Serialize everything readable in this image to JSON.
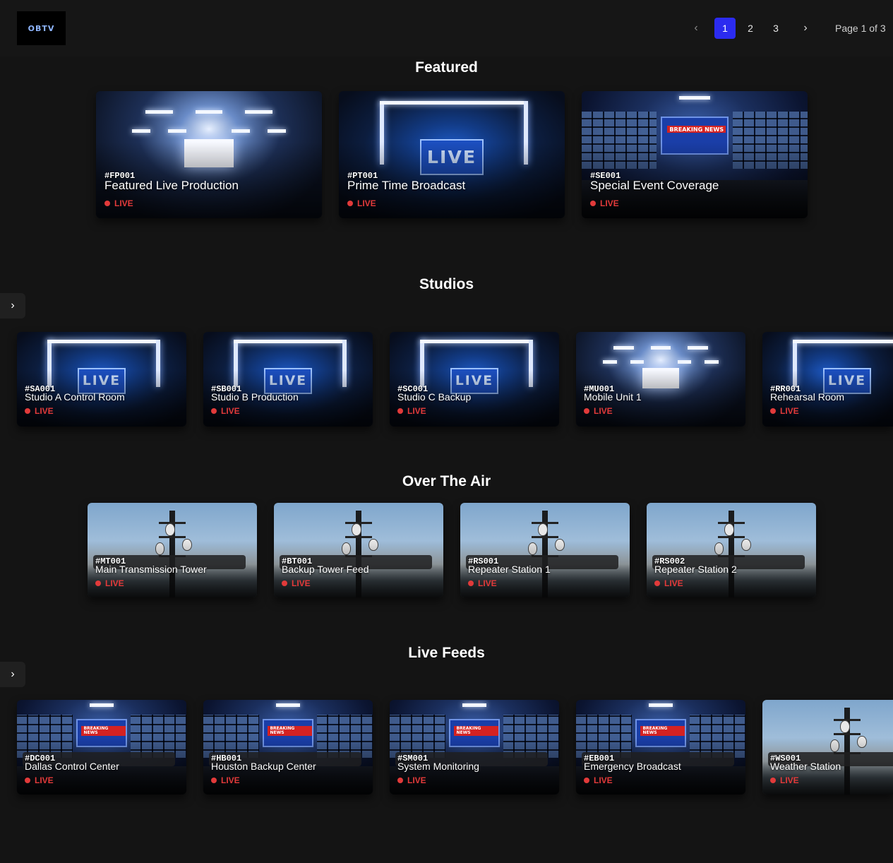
{
  "header": {
    "logo_text": "OBTV",
    "pagination": {
      "prev_icon": "chevron-left-icon",
      "next_icon": "chevron-right-icon",
      "pages": [
        "1",
        "2",
        "3"
      ],
      "current_page": "1",
      "status": "Page 1 of 3"
    }
  },
  "colors": {
    "accent": "#2b2bf0",
    "live": "#e23a3a",
    "background": "#141414"
  },
  "featured": {
    "title": "Featured",
    "cards": [
      {
        "code": "#FP001",
        "name": "Featured Live Production",
        "status": "LIVE",
        "scene": "production"
      },
      {
        "code": "#PT001",
        "name": "Prime Time Broadcast",
        "status": "LIVE",
        "scene": "live-studio"
      },
      {
        "code": "#SE001",
        "name": "Special Event Coverage",
        "status": "LIVE",
        "scene": "control-room"
      }
    ]
  },
  "studios": {
    "title": "Studios",
    "arrow_icon": "chevron-right-icon",
    "cards": [
      {
        "code": "#SA001",
        "name": "Studio A Control Room",
        "status": "LIVE",
        "scene": "live-studio"
      },
      {
        "code": "#SB001",
        "name": "Studio B Production",
        "status": "LIVE",
        "scene": "live-studio"
      },
      {
        "code": "#SC001",
        "name": "Studio C Backup",
        "status": "LIVE",
        "scene": "live-studio"
      },
      {
        "code": "#MU001",
        "name": "Mobile Unit 1",
        "status": "LIVE",
        "scene": "production"
      },
      {
        "code": "#RR001",
        "name": "Rehearsal Room",
        "status": "LIVE",
        "scene": "live-studio"
      }
    ]
  },
  "over_the_air": {
    "title": "Over The Air",
    "cards": [
      {
        "code": "#MT001",
        "name": "Main Transmission Tower",
        "status": "LIVE",
        "scene": "tower"
      },
      {
        "code": "#BT001",
        "name": "Backup Tower Feed",
        "status": "LIVE",
        "scene": "tower"
      },
      {
        "code": "#RS001",
        "name": "Repeater Station 1",
        "status": "LIVE",
        "scene": "tower"
      },
      {
        "code": "#RS002",
        "name": "Repeater Station 2",
        "status": "LIVE",
        "scene": "tower"
      }
    ]
  },
  "live_feeds": {
    "title": "Live Feeds",
    "arrow_icon": "chevron-right-icon",
    "cards": [
      {
        "code": "#DC001",
        "name": "Dallas Control Center",
        "status": "LIVE",
        "scene": "control-room"
      },
      {
        "code": "#HB001",
        "name": "Houston Backup Center",
        "status": "LIVE",
        "scene": "control-room"
      },
      {
        "code": "#SM001",
        "name": "System Monitoring",
        "status": "LIVE",
        "scene": "control-room"
      },
      {
        "code": "#EB001",
        "name": "Emergency Broadcast",
        "status": "LIVE",
        "scene": "control-room"
      },
      {
        "code": "#WS001",
        "name": "Weather Station",
        "status": "LIVE",
        "scene": "tower"
      }
    ]
  },
  "scene_text": {
    "live_sign": "LIVE",
    "breaking": "BREAKING NEWS"
  }
}
